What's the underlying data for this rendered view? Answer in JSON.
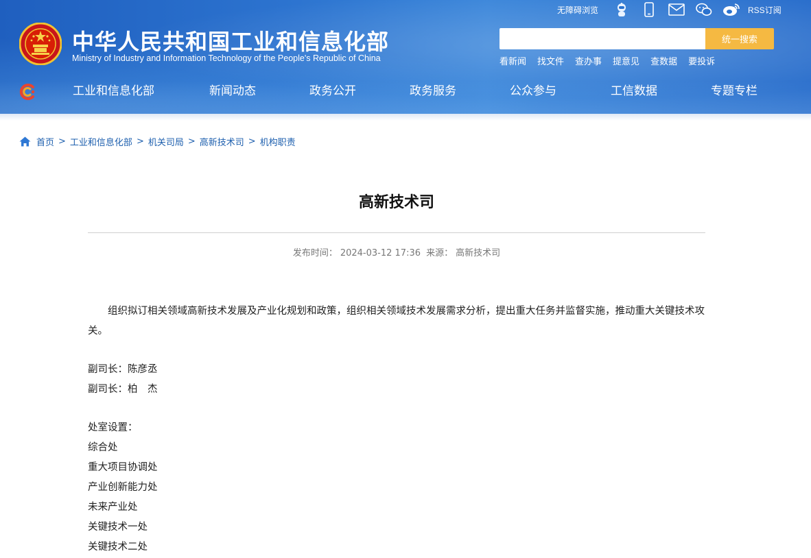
{
  "header": {
    "title": "中华人民共和国工业和信息化部",
    "subtitle": "Ministry of Industry and Information Technology of the People's Republic of China",
    "toplinks": {
      "accessibility": "无障碍浏览",
      "rss": "RSS订阅"
    },
    "icons": [
      "robot-icon",
      "mobile-icon",
      "mail-icon",
      "wechat-icon",
      "weibo-icon"
    ],
    "search": {
      "placeholder": "",
      "button": "统一搜索"
    },
    "quick_links": [
      "看新闻",
      "找文件",
      "查办事",
      "提意见",
      "查数据",
      "要投诉"
    ],
    "nav": [
      "工业和信息化部",
      "新闻动态",
      "政务公开",
      "政务服务",
      "公众参与",
      "工信数据",
      "专题专栏"
    ]
  },
  "breadcrumb": [
    "首页",
    "工业和信息化部",
    "机关司局",
    "高新技术司",
    "机构职责"
  ],
  "article": {
    "title": "高新技术司",
    "publish_label": "发布时间：",
    "publish_time": "2024-03-12 17:36",
    "source_label": "来源：",
    "source": "高新技术司",
    "paragraph": "组织拟订相关领域高新技术发展及产业化规划和政策，组织相关领域技术发展需求分析，提出重大任务并监督实施，推动重大关键技术攻关。",
    "leaders": [
      "副司长：陈彦丞",
      "副司长：柏　杰"
    ],
    "divisions_label": "处室设置：",
    "divisions": [
      "综合处",
      "重大项目协调处",
      "产业创新能力处",
      "未来产业处",
      "关键技术一处",
      "关键技术二处"
    ]
  },
  "colors": {
    "header_blue": "#2c73cf",
    "search_button": "#f5b942",
    "link": "#1d5fae"
  }
}
